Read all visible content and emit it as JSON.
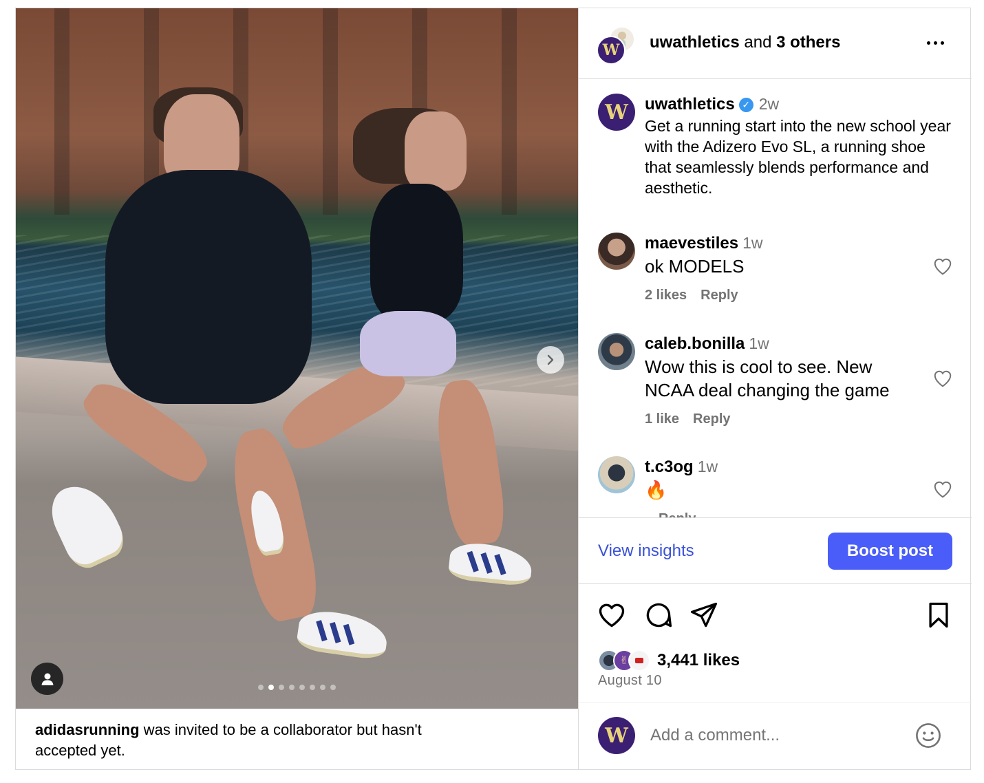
{
  "post": {
    "collab_note": {
      "user": "adidasrunning",
      "text": " was invited to be a collaborator but hasn't accepted yet."
    },
    "header": {
      "user": "uwathletics",
      "joiner": " and ",
      "others": "3 others"
    },
    "caption": {
      "user": "uwathletics",
      "time": "2w",
      "text": "Get a running start into the new school year with the Adizero Evo SL, a running shoe that seamlessly blends performance and aesthetic."
    },
    "comments": [
      {
        "user": "maevestiles",
        "time": "1w",
        "text": "ok MODELS",
        "likes": "2 likes",
        "reply": "Reply"
      },
      {
        "user": "caleb.bonilla",
        "time": "1w",
        "text": "Wow this is cool to see. New NCAA deal changing the game",
        "likes": "1 like",
        "reply": "Reply"
      },
      {
        "user": "t.c3og",
        "time": "1w",
        "text": "🔥",
        "likes": "",
        "reply": "Reply"
      }
    ],
    "insights": {
      "view_label": "View insights",
      "boost_label": "Boost post"
    },
    "likes": "3,441 likes",
    "date": "August 10",
    "add_comment": {
      "placeholder": "Add a comment..."
    },
    "carousel": {
      "count": 8,
      "active_index": 1
    }
  },
  "icons": {
    "more": "more-horizontal-icon",
    "verified": "verified-badge-icon",
    "next": "chevron-right-icon",
    "tag": "user-tag-icon",
    "like": "heart-icon",
    "comment": "comment-icon",
    "share": "send-icon",
    "save": "bookmark-icon",
    "emoji": "emoji-icon"
  },
  "colors": {
    "accent": "#4a5df9",
    "link": "#3a52d6",
    "verified": "#3897f0",
    "secondary_text": "#737373",
    "uw_purple": "#3b1f73",
    "uw_gold": "#e8d27a"
  }
}
